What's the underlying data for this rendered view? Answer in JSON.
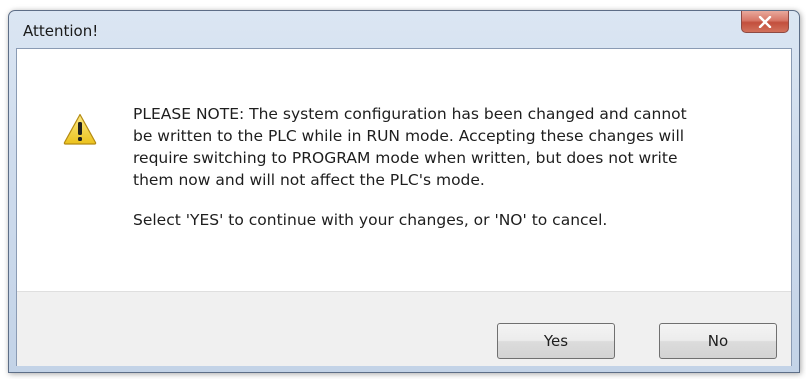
{
  "window": {
    "title": "Attention!",
    "close_icon": "close-icon"
  },
  "dialog": {
    "icon": "warning-icon",
    "message_paragraphs": [
      "PLEASE NOTE: The system configuration has been changed and cannot\nbe written to the PLC while in RUN mode. Accepting these changes will\nrequire switching to PROGRAM mode when written, but does not write\nthem now and will not affect the PLC's mode.",
      "Select 'YES' to continue with your changes, or 'NO' to cancel."
    ]
  },
  "buttons": {
    "yes_label": "Yes",
    "no_label": "No"
  },
  "colors": {
    "close_button": "#c24f3d",
    "warning_yellow": "#f6d23c",
    "footer_background": "#f0f0f0"
  }
}
